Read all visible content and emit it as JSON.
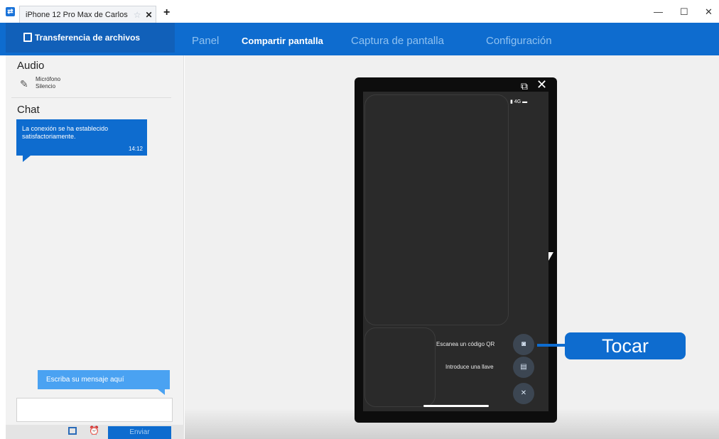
{
  "window": {
    "tab_title": "iPhone 12 Pro Max de Carlos",
    "new_tab_symbol": "+",
    "controls": {
      "minimize": "—",
      "maximize": "☐",
      "close": "✕"
    }
  },
  "nav": {
    "file_transfer": "Transferencia de archivos",
    "tabs": [
      {
        "label": "Panel",
        "active": false
      },
      {
        "label": "Compartir pantalla",
        "active": true
      },
      {
        "label": "Captura de pantalla",
        "active": false
      },
      {
        "label": "Configuración",
        "active": false
      }
    ]
  },
  "sidebar": {
    "audio_title": "Audio",
    "mic_label": "Micrófono",
    "mic_status": "Silencio",
    "chat_title": "Chat",
    "chat_message": "La conexión se ha establecido satisfactoriamente.",
    "chat_time": "14:12",
    "compose_hint": "Escriba su mensaje aquí",
    "message_value": "",
    "send_label": "Enviar"
  },
  "phone": {
    "status": "4G",
    "actions": [
      {
        "label": "Escanea un código QR",
        "icon": "camera-icon"
      },
      {
        "label": "Introduce una llave",
        "icon": "keyboard-icon"
      }
    ],
    "close_fab_icon": "close-icon"
  },
  "annotation": {
    "tap_label": "Tocar"
  },
  "colors": {
    "brand": "#0e6ccf",
    "sidebar_bg": "#f2f2f2",
    "phone_screen": "#2a2a2a"
  }
}
